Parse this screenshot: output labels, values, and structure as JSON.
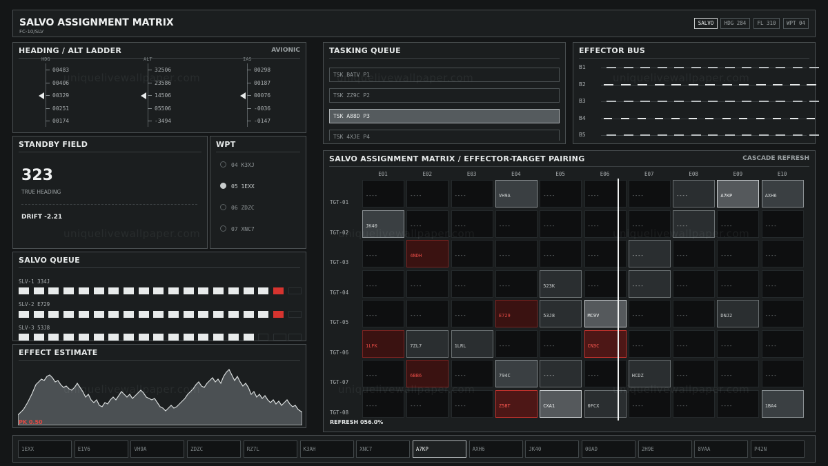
{
  "header": {
    "title": "SALVO ASSIGNMENT MATRIX",
    "subtitle": "FC-10/SLV",
    "tabs": [
      {
        "label": "SALVO",
        "active": true
      },
      {
        "label": "HDG 284",
        "active": false
      },
      {
        "label": "FL 310",
        "active": false
      },
      {
        "label": "WPT 04",
        "active": false
      }
    ]
  },
  "ladder": {
    "title": "HEADING / ALT LADDER",
    "tag": "AVIONIC",
    "columns": [
      {
        "label": "HDG",
        "values": [
          "00483",
          "00406",
          "00329",
          "00251",
          "00174"
        ],
        "selected": 2
      },
      {
        "label": "ALT",
        "values": [
          "32506",
          "23586",
          "14506",
          "05506",
          "-3494"
        ],
        "selected": 2
      },
      {
        "label": "IAS",
        "values": [
          "00298",
          "00187",
          "00076",
          "-0036",
          "-0147"
        ],
        "selected": 2
      }
    ]
  },
  "tasking": {
    "title": "TASKING QUEUE",
    "items": [
      {
        "label": "TSK BATV  P1",
        "selected": false
      },
      {
        "label": "TSK ZZ9C  P2",
        "selected": false
      },
      {
        "label": "TSK A88D  P3",
        "selected": true
      },
      {
        "label": "TSK 4XJE  P4",
        "selected": false
      }
    ]
  },
  "effector_bus": {
    "title": "EFFECTOR BUS",
    "buses": [
      "B1",
      "B2",
      "B3",
      "B4",
      "B5"
    ]
  },
  "standby": {
    "title": "STANDBY FIELD",
    "value": "323",
    "value_label": "TRUE HEADING",
    "drift": "DRIFT -2.21"
  },
  "wpt": {
    "title": "WPT",
    "items": [
      {
        "label": "04 K3XJ",
        "selected": false
      },
      {
        "label": "05 1EXX",
        "selected": true
      },
      {
        "label": "06 ZDZC",
        "selected": false
      },
      {
        "label": "07 XNC7",
        "selected": false
      }
    ]
  },
  "salvo_queue": {
    "title": "SALVO QUEUE",
    "rows": [
      {
        "label": "SLV-1 334J",
        "filled": 17,
        "red": true,
        "total": 19
      },
      {
        "label": "SLV-2 E729",
        "filled": 17,
        "red": true,
        "total": 19
      },
      {
        "label": "SLV-3 53J8",
        "filled": 16,
        "red": false,
        "total": 19
      }
    ]
  },
  "effect": {
    "title": "EFFECT ESTIMATE",
    "pk": "PK 0.50"
  },
  "matrix": {
    "title": "SALVO ASSIGNMENT MATRIX / EFFECTOR-TARGET PAIRING",
    "tag": "CASCADE REFRESH",
    "columns": [
      "E01",
      "E02",
      "E03",
      "E04",
      "E05",
      "E06",
      "E07",
      "E08",
      "E09",
      "E10"
    ],
    "rows": [
      {
        "label": "TGT-01",
        "cells": [
          [
            "----",
            ""
          ],
          [
            "----",
            ""
          ],
          [
            "----",
            ""
          ],
          [
            "VH9A",
            "g2"
          ],
          [
            "----",
            ""
          ],
          [
            "----",
            ""
          ],
          [
            "----",
            ""
          ],
          [
            "----",
            "g1"
          ],
          [
            "A7KP",
            "g3"
          ],
          [
            "AXH6",
            "g2"
          ]
        ]
      },
      {
        "label": "TGT-02",
        "cells": [
          [
            "JK40",
            "g2"
          ],
          [
            "----",
            ""
          ],
          [
            "----",
            ""
          ],
          [
            "----",
            ""
          ],
          [
            "----",
            ""
          ],
          [
            "----",
            ""
          ],
          [
            "----",
            ""
          ],
          [
            "----",
            "g1"
          ],
          [
            "----",
            ""
          ],
          [
            "----",
            ""
          ]
        ]
      },
      {
        "label": "TGT-03",
        "cells": [
          [
            "----",
            ""
          ],
          [
            "4NDH",
            "r"
          ],
          [
            "----",
            ""
          ],
          [
            "----",
            ""
          ],
          [
            "----",
            ""
          ],
          [
            "----",
            ""
          ],
          [
            "----",
            "g1"
          ],
          [
            "----",
            ""
          ],
          [
            "----",
            ""
          ],
          [
            "----",
            ""
          ]
        ]
      },
      {
        "label": "TGT-04",
        "cells": [
          [
            "----",
            ""
          ],
          [
            "----",
            ""
          ],
          [
            "----",
            ""
          ],
          [
            "----",
            ""
          ],
          [
            "523K",
            "g1"
          ],
          [
            "----",
            ""
          ],
          [
            "----",
            "g1"
          ],
          [
            "----",
            ""
          ],
          [
            "----",
            ""
          ],
          [
            "----",
            ""
          ]
        ]
      },
      {
        "label": "TGT-05",
        "cells": [
          [
            "----",
            ""
          ],
          [
            "----",
            ""
          ],
          [
            "----",
            ""
          ],
          [
            "E729",
            "r"
          ],
          [
            "53J8",
            "g1"
          ],
          [
            "MC9V",
            "g3"
          ],
          [
            "----",
            ""
          ],
          [
            "----",
            ""
          ],
          [
            "DNJ2",
            "g1"
          ],
          [
            "----",
            ""
          ]
        ]
      },
      {
        "label": "TGT-06",
        "cells": [
          [
            "1LFK",
            "r"
          ],
          [
            "7ZL7",
            "g1"
          ],
          [
            "1LRL",
            "g1"
          ],
          [
            "----",
            ""
          ],
          [
            "----",
            ""
          ],
          [
            "CN3C",
            "r2"
          ],
          [
            "----",
            ""
          ],
          [
            "----",
            ""
          ],
          [
            "----",
            ""
          ],
          [
            "----",
            ""
          ]
        ]
      },
      {
        "label": "TGT-07",
        "cells": [
          [
            "----",
            ""
          ],
          [
            "6BB6",
            "r"
          ],
          [
            "----",
            ""
          ],
          [
            "794C",
            "g2"
          ],
          [
            "----",
            "g1"
          ],
          [
            "----",
            ""
          ],
          [
            "HCDZ",
            "g1"
          ],
          [
            "----",
            ""
          ],
          [
            "----",
            ""
          ],
          [
            "----",
            ""
          ]
        ]
      },
      {
        "label": "TGT-08",
        "cells": [
          [
            "----",
            ""
          ],
          [
            "----",
            ""
          ],
          [
            "----",
            ""
          ],
          [
            "Z58T",
            "r2"
          ],
          [
            "CXA1",
            "g3"
          ],
          [
            "0FCX",
            "g1"
          ],
          [
            "----",
            ""
          ],
          [
            "----",
            ""
          ],
          [
            "----",
            ""
          ],
          [
            "1BA4",
            "g2"
          ]
        ]
      }
    ],
    "refresh": "REFRESH 056.0%"
  },
  "footer_chips": [
    {
      "label": "1EXX",
      "active": false
    },
    {
      "label": "E1V6",
      "active": false
    },
    {
      "label": "VH9A",
      "active": false
    },
    {
      "label": "ZDZC",
      "active": false
    },
    {
      "label": "RZ7L",
      "active": false
    },
    {
      "label": "K3AH",
      "active": false
    },
    {
      "label": "XNC7",
      "active": false
    },
    {
      "label": "A7KP",
      "active": true
    },
    {
      "label": "AXH6",
      "active": false
    },
    {
      "label": "JK40",
      "active": false
    },
    {
      "label": "00AD",
      "active": false
    },
    {
      "label": "2H9E",
      "active": false
    },
    {
      "label": "8VAA",
      "active": false
    },
    {
      "label": "P42N",
      "active": false
    }
  ],
  "watermark": "uniquelivewallpaper.com",
  "colors": {
    "accent_red": "#d6342f",
    "panel_border": "#4a4f51",
    "background": "#141617"
  }
}
